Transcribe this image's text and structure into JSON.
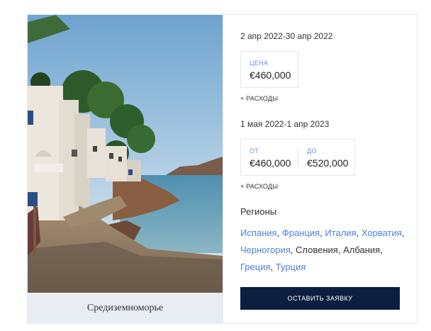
{
  "card": {
    "caption": "Средиземноморье",
    "period1": {
      "dates": "2 апр 2022-30 апр 2022",
      "price_label": "ЦЕНА",
      "price_value": "€460,000",
      "expenses": "+ РАСХОДЫ"
    },
    "period2": {
      "dates": "1 мая 2022-1 апр 2023",
      "from_label": "ОТ",
      "from_value": "€460,000",
      "to_label": "ДО",
      "to_value": "€520,000",
      "expenses": "+ РАСХОДЫ"
    },
    "regions_title": "Регионы",
    "regions": [
      {
        "name": "Испания",
        "link": true,
        "sep": ", "
      },
      {
        "name": "Франция",
        "link": true,
        "sep": ", "
      },
      {
        "name": "Италия",
        "link": true,
        "sep": ", "
      },
      {
        "name": "Хорватия",
        "link": true,
        "sep": ", "
      },
      {
        "name": "Черногория",
        "link": true,
        "sep": ", "
      },
      {
        "name": "Словения",
        "link": false,
        "sep": ", "
      },
      {
        "name": "Албания",
        "link": false,
        "sep": ", "
      },
      {
        "name": "Греция",
        "link": true,
        "sep": ", "
      },
      {
        "name": "Турция",
        "link": true,
        "sep": ""
      }
    ],
    "cta_label": "ОСТАВИТЬ ЗАЯВКУ",
    "colors": {
      "accent_link": "#4b7fe0",
      "button_bg": "#0c1f40",
      "caption_bg": "#e8ecf3"
    }
  }
}
